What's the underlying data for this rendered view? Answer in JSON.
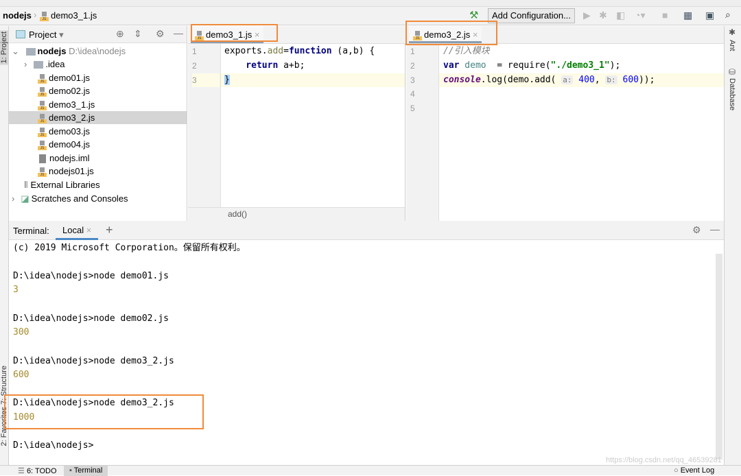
{
  "breadcrumb": {
    "project": "nodejs",
    "file": "demo3_1.js"
  },
  "toolbar": {
    "add_configuration": "Add Configuration..."
  },
  "left_strip": {
    "project": "1: Project",
    "structure": "7: Structure",
    "favorites": "2: Favorites"
  },
  "right_strip": {
    "ant": "Ant",
    "database": "Database"
  },
  "project_panel": {
    "title": "Project",
    "root": {
      "name": "nodejs",
      "path": "D:\\idea\\nodejs"
    },
    "items": [
      {
        "label": ".idea",
        "type": "folder"
      },
      {
        "label": "demo01.js",
        "type": "js"
      },
      {
        "label": "demo02.js",
        "type": "js"
      },
      {
        "label": "demo3_1.js",
        "type": "js"
      },
      {
        "label": "demo3_2.js",
        "type": "js",
        "selected": true
      },
      {
        "label": "demo03.js",
        "type": "js"
      },
      {
        "label": "demo04.js",
        "type": "js"
      },
      {
        "label": "nodejs.iml",
        "type": "iml"
      },
      {
        "label": "nodejs01.js",
        "type": "js"
      }
    ],
    "external": "External Libraries",
    "scratches": "Scratches and Consoles"
  },
  "editor1": {
    "tab": "demo3_1.js",
    "lines": [
      "1",
      "2",
      "3"
    ],
    "code": {
      "l1a": "exports.",
      "l1b": "add",
      "l1c": "=",
      "l1d": "function",
      "l1e": " (a,b) {",
      "l2a": "    return",
      "l2b": " a+b;",
      "l3": "}"
    },
    "footer": "add()"
  },
  "editor2": {
    "tab": "demo3_2.js",
    "lines": [
      "1",
      "2",
      "3",
      "4",
      "5"
    ],
    "code": {
      "l1": "//引入模块",
      "l2a": "var",
      "l2b": " demo",
      "l2c": "  = require(",
      "l2d": "\"./demo3_1\"",
      "l2e": ");",
      "l3a": "console",
      "l3b": ".log(demo.add( ",
      "l3h1": "a:",
      "l3n1": "400",
      "l3c": ", ",
      "l3h2": "b:",
      "l3n2": "600",
      "l3d": "));"
    }
  },
  "terminal": {
    "label": "Terminal:",
    "tab": "Local",
    "lines": [
      "(c) 2019 Microsoft Corporation。保留所有权利。",
      "D:\\idea\\nodejs>node demo01.js",
      "3",
      "D:\\idea\\nodejs>node demo02.js",
      "300",
      "D:\\idea\\nodejs>node demo3_2.js",
      "600",
      "D:\\idea\\nodejs>node demo3_2.js",
      "1000",
      "D:\\idea\\nodejs>"
    ]
  },
  "bottom_bar": {
    "todo": "6: TODO",
    "terminal": "Terminal",
    "event_log": "Event Log"
  },
  "watermark": "https://blog.csdn.net/qq_46539281",
  "colors": {
    "highlight_box": "#f08a3a",
    "output": "#a48a2a"
  }
}
